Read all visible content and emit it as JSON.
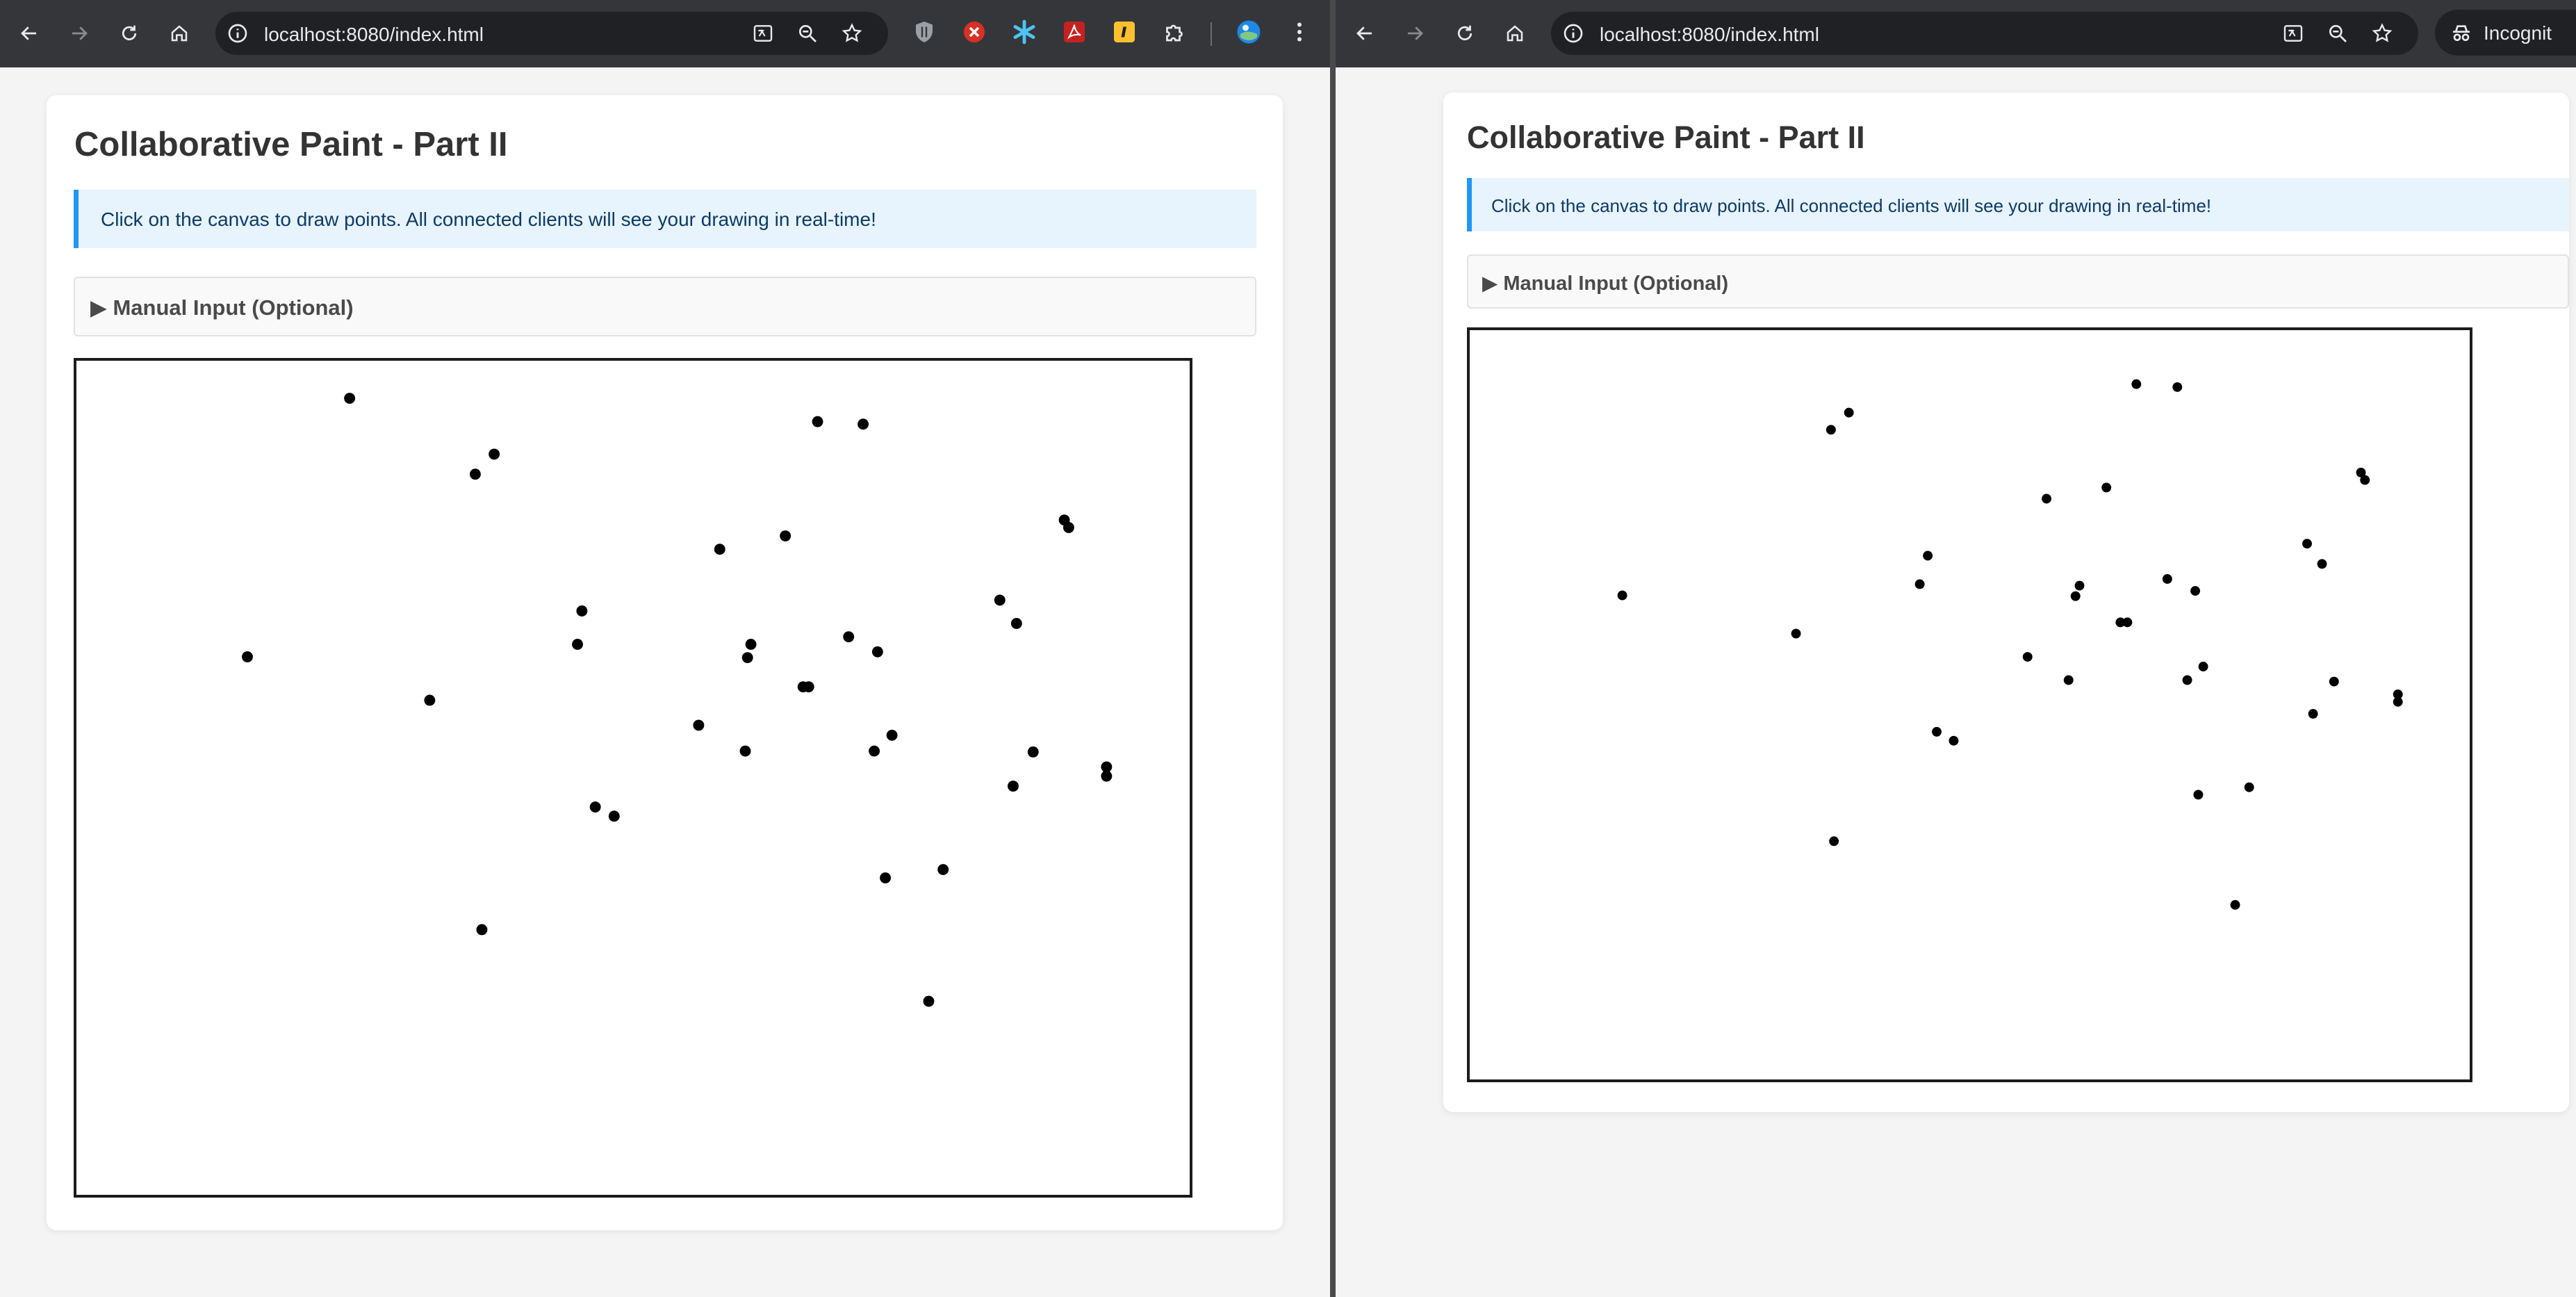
{
  "browser_left": {
    "url": "localhost:8080/index.html"
  },
  "browser_right": {
    "url": "localhost:8080/index.html",
    "incognito_label": "Incognit"
  },
  "app": {
    "title": "Collaborative Paint - Part II",
    "info_text": "Click on the canvas to draw points. All connected clients will see your drawing in real-time!",
    "manual_input_label": "▶ Manual Input (Optional)"
  },
  "colors": {
    "accent": "#2196f3",
    "point": "#000000",
    "info_bg": "#e7f3fd",
    "browser_chrome": "#35363a"
  },
  "canvas_left": {
    "points": [
      [
        0.245,
        0.045
      ],
      [
        0.375,
        0.112
      ],
      [
        0.358,
        0.136
      ],
      [
        0.666,
        0.073
      ],
      [
        0.707,
        0.076
      ],
      [
        0.153,
        0.355
      ],
      [
        0.317,
        0.407
      ],
      [
        0.454,
        0.3
      ],
      [
        0.45,
        0.34
      ],
      [
        0.578,
        0.226
      ],
      [
        0.637,
        0.21
      ],
      [
        0.888,
        0.191
      ],
      [
        0.892,
        0.2
      ],
      [
        0.83,
        0.287
      ],
      [
        0.845,
        0.315
      ],
      [
        0.606,
        0.34
      ],
      [
        0.603,
        0.356
      ],
      [
        0.694,
        0.331
      ],
      [
        0.72,
        0.349
      ],
      [
        0.653,
        0.391
      ],
      [
        0.658,
        0.391
      ],
      [
        0.559,
        0.437
      ],
      [
        0.601,
        0.468
      ],
      [
        0.733,
        0.449
      ],
      [
        0.717,
        0.468
      ],
      [
        0.86,
        0.469
      ],
      [
        0.926,
        0.487
      ],
      [
        0.926,
        0.498
      ],
      [
        0.842,
        0.51
      ],
      [
        0.466,
        0.535
      ],
      [
        0.483,
        0.546
      ],
      [
        0.364,
        0.682
      ],
      [
        0.779,
        0.61
      ],
      [
        0.727,
        0.62
      ],
      [
        0.766,
        0.768
      ]
    ]
  },
  "canvas_right": {
    "points": [
      [
        0.152,
        0.354
      ],
      [
        0.361,
        0.133
      ],
      [
        0.379,
        0.11
      ],
      [
        0.667,
        0.072
      ],
      [
        0.708,
        0.076
      ],
      [
        0.577,
        0.225
      ],
      [
        0.637,
        0.21
      ],
      [
        0.892,
        0.19
      ],
      [
        0.896,
        0.2
      ],
      [
        0.838,
        0.285
      ],
      [
        0.853,
        0.312
      ],
      [
        0.458,
        0.301
      ],
      [
        0.45,
        0.339
      ],
      [
        0.61,
        0.341
      ],
      [
        0.606,
        0.355
      ],
      [
        0.698,
        0.332
      ],
      [
        0.726,
        0.348
      ],
      [
        0.651,
        0.39
      ],
      [
        0.658,
        0.39
      ],
      [
        0.326,
        0.405
      ],
      [
        0.558,
        0.436
      ],
      [
        0.599,
        0.467
      ],
      [
        0.734,
        0.449
      ],
      [
        0.718,
        0.467
      ],
      [
        0.865,
        0.469
      ],
      [
        0.929,
        0.486
      ],
      [
        0.929,
        0.496
      ],
      [
        0.844,
        0.512
      ],
      [
        0.467,
        0.536
      ],
      [
        0.484,
        0.548
      ],
      [
        0.364,
        0.682
      ],
      [
        0.78,
        0.61
      ],
      [
        0.729,
        0.62
      ],
      [
        0.766,
        0.767
      ]
    ]
  }
}
